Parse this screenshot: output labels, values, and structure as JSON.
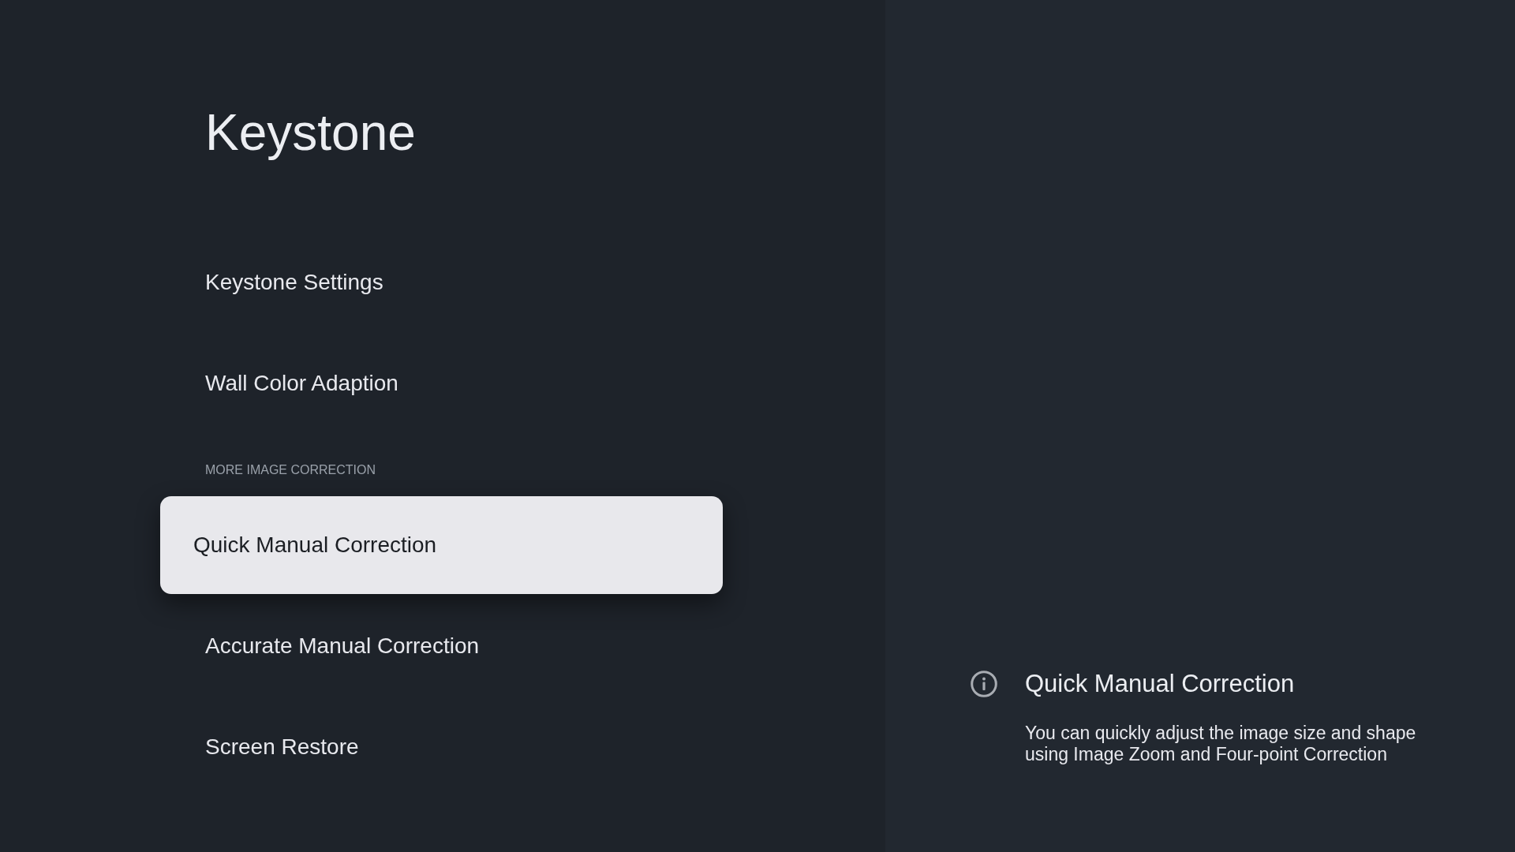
{
  "header": {
    "title": "Keystone"
  },
  "menu": {
    "sections": [
      {
        "items": [
          {
            "label": "Keystone Settings",
            "selected": false
          },
          {
            "label": "Wall Color Adaption",
            "selected": false
          }
        ]
      },
      {
        "heading": "MORE IMAGE CORRECTION",
        "items": [
          {
            "label": "Quick Manual Correction",
            "selected": true
          },
          {
            "label": "Accurate Manual Correction",
            "selected": false
          },
          {
            "label": "Screen Restore",
            "selected": false
          }
        ]
      }
    ]
  },
  "info_panel": {
    "title": "Quick Manual Correction",
    "description": "You can quickly adjust the image size and shape using Image Zoom and Four-point Correction"
  }
}
